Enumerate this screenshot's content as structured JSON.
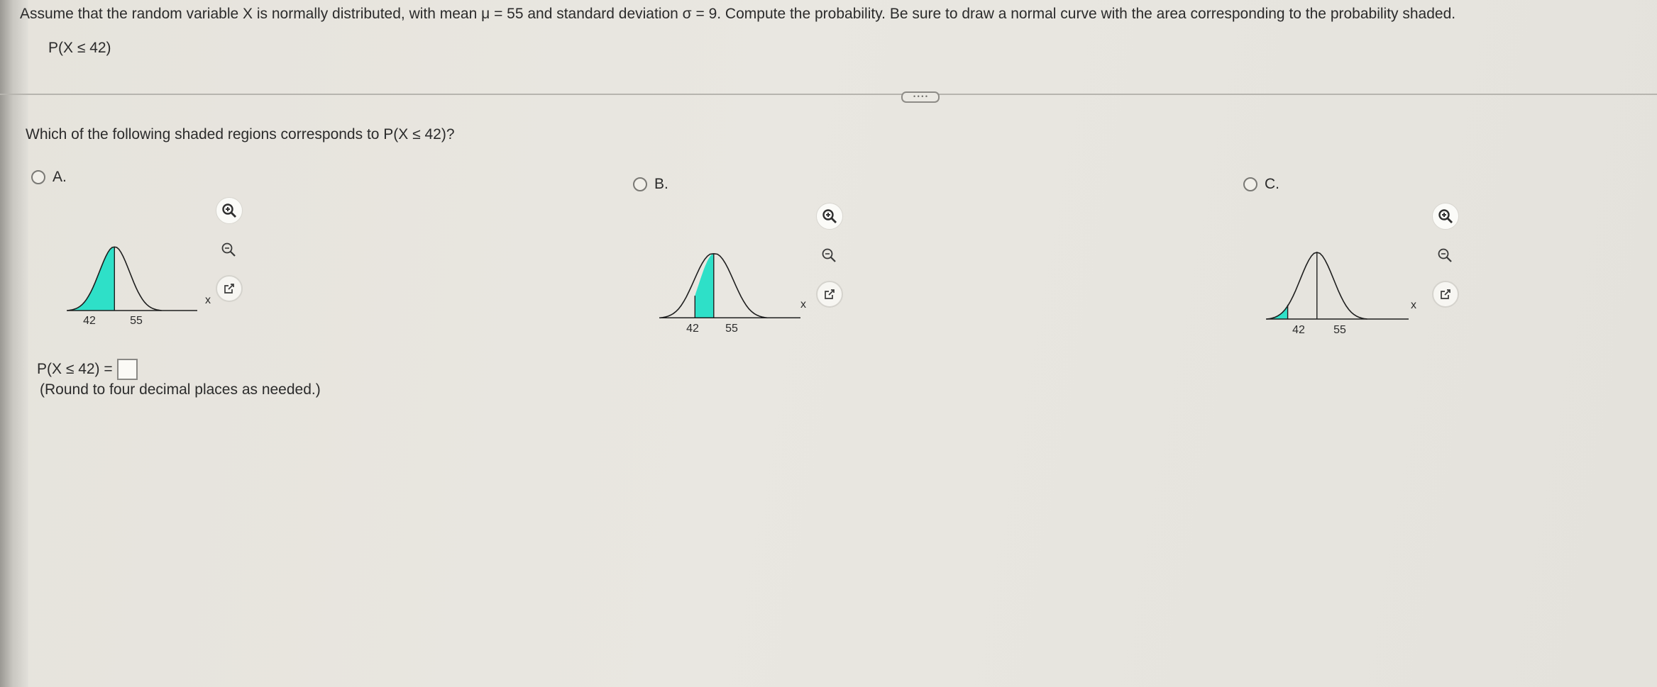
{
  "question": {
    "text": "Assume that the random variable X is normally distributed, with mean μ = 55 and standard deviation σ = 9. Compute the probability. Be sure to draw a normal curve with the area corresponding to the probability shaded.",
    "probability": "P(X ≤ 42)"
  },
  "handle_label": "• • • •",
  "prompt": "Which of the following shaded regions corresponds to P(X ≤ 42)?",
  "options": [
    {
      "letter": "A.",
      "tick_low": "42",
      "tick_mean": "55",
      "axis_var": "x",
      "shade": "left-of-mean"
    },
    {
      "letter": "B.",
      "tick_low": "42",
      "tick_mean": "55",
      "axis_var": "x",
      "shade": "between-42-and-55"
    },
    {
      "letter": "C.",
      "tick_low": "42",
      "tick_mean": "55",
      "axis_var": "x",
      "shade": "left-of-42"
    }
  ],
  "answer": {
    "label": "P(X ≤ 42) =",
    "value": ""
  },
  "note": "(Round to four decimal places as needed.)",
  "colors": {
    "shade": "#2ee0c8",
    "curve": "#1f1f1f"
  },
  "icons": [
    "zoom-in-icon",
    "zoom-out-icon",
    "external-link-icon"
  ]
}
